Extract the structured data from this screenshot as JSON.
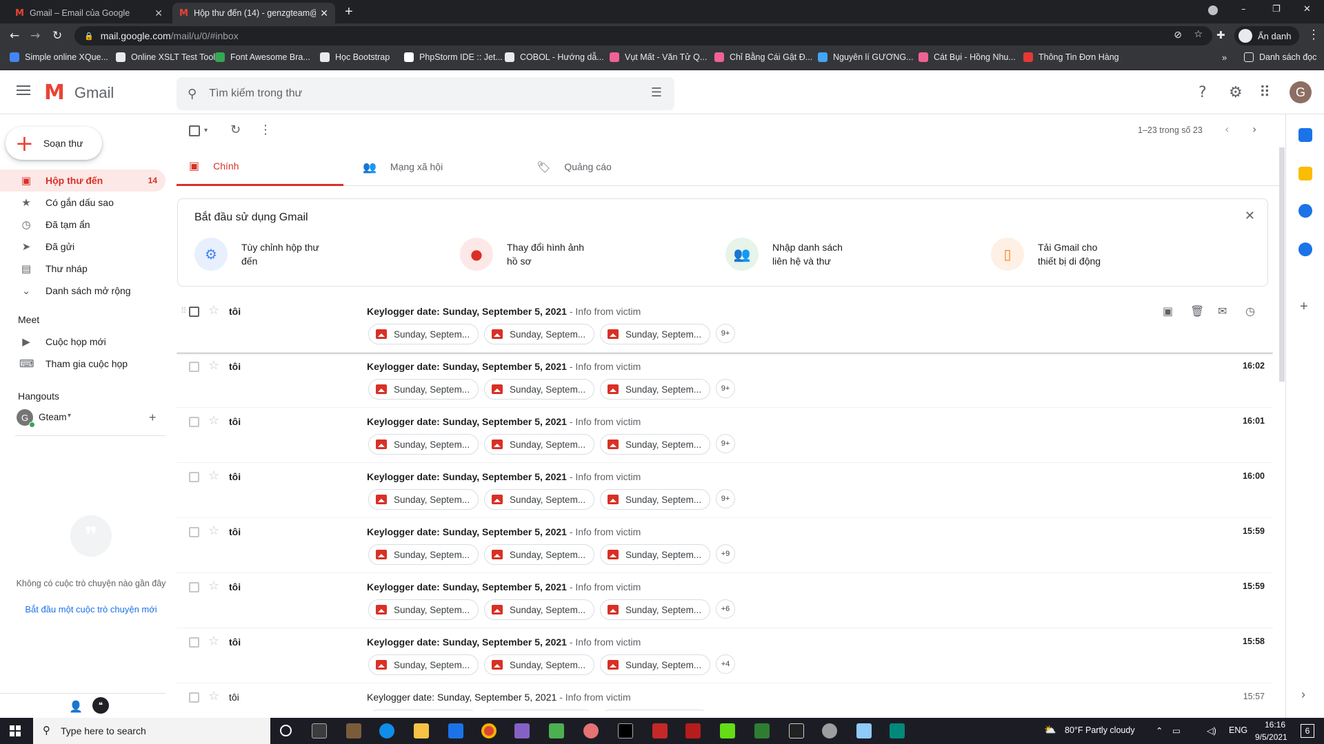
{
  "browser": {
    "tabs": [
      {
        "label": "Gmail – Email của Google",
        "active": false
      },
      {
        "label": "Hộp thư đến (14) - genzgteam@",
        "active": true
      }
    ],
    "url_host": "mail.google.com",
    "url_path": "/mail/u/0/#inbox",
    "profile_label": "Ẩn danh",
    "bookmarks": [
      {
        "label": "Simple online XQue...",
        "color": "#4285f4"
      },
      {
        "label": "Online XSLT Test Tool",
        "color": "#e8eaed"
      },
      {
        "label": "Font Awesome Bra...",
        "color": "#34a853"
      },
      {
        "label": "Học Bootstrap",
        "color": "#e8eaed"
      },
      {
        "label": "PhpStorm IDE :: Jet...",
        "color": "#ffffff"
      },
      {
        "label": "COBOL - Hướng dẫ...",
        "color": "#e8eaed"
      },
      {
        "label": "Vụt Mất - Văn Tử Q...",
        "color": "#f06292"
      },
      {
        "label": "Chỉ Bằng Cái Gật Đ...",
        "color": "#f06292"
      },
      {
        "label": "Nguyên lí GƯƠNG...",
        "color": "#42a5f5"
      },
      {
        "label": "Cát Bụi - Hồng Nhu...",
        "color": "#f06292"
      },
      {
        "label": "Thông Tin Đơn Hàng",
        "color": "#e53935"
      }
    ],
    "reading_list": "Danh sách đọc"
  },
  "gmail": {
    "logo_text": "Gmail",
    "search_placeholder": "Tìm kiếm trong thư",
    "avatar_letter": "G",
    "compose_label": "Soạn thư",
    "nav": [
      {
        "label": "Hộp thư đến",
        "count": "14",
        "icon": "inbox-icon",
        "glyph": "▣",
        "active": true
      },
      {
        "label": "Có gắn dấu sao",
        "count": "",
        "icon": "star-icon",
        "glyph": "★",
        "active": false
      },
      {
        "label": "Đã tạm ẩn",
        "count": "",
        "icon": "clock-icon",
        "glyph": "◷",
        "active": false
      },
      {
        "label": "Đã gửi",
        "count": "",
        "icon": "send-icon",
        "glyph": "➤",
        "active": false
      },
      {
        "label": "Thư nháp",
        "count": "",
        "icon": "draft-icon",
        "glyph": "▤",
        "active": false
      },
      {
        "label": "Danh sách mở rộng",
        "count": "",
        "icon": "chevron-down-icon",
        "glyph": "⌄",
        "active": false
      }
    ],
    "meet": {
      "title": "Meet",
      "items": [
        "Cuộc họp mới",
        "Tham gia cuộc họp"
      ]
    },
    "hangouts": {
      "title": "Hangouts",
      "user": "Gteam",
      "empty_text": "Không có cuộc trò chuyện nào gần đây",
      "start_link": "Bắt đầu một cuộc trò chuyện mới"
    },
    "pagination": "1–23 trong số 23",
    "category_tabs": [
      {
        "label": "Chính",
        "active": true
      },
      {
        "label": "Mạng xã hội",
        "active": false
      },
      {
        "label": "Quảng cáo",
        "active": false
      }
    ],
    "getting_started": {
      "title": "Bắt đầu sử dụng Gmail",
      "items": [
        {
          "line1": "Tùy chỉnh hộp thư",
          "line2": "đến",
          "bg": "#e8f0fe",
          "fg": "#4285f4",
          "glyph": "⚙"
        },
        {
          "line1": "Thay đổi hình ảnh",
          "line2": "hồ sơ",
          "bg": "#fce8e6",
          "fg": "#d93025",
          "glyph": "●"
        },
        {
          "line1": "Nhập danh sách",
          "line2": "liên hệ và thư",
          "bg": "#e6f4ea",
          "fg": "#1e8e3e",
          "glyph": "👥"
        },
        {
          "line1": "Tải Gmail cho",
          "line2": "thiết bị di động",
          "bg": "#fef0e5",
          "fg": "#fa7b17",
          "glyph": "▯"
        }
      ]
    },
    "emails": [
      {
        "sender": "tôi",
        "subject": "Keylogger date: Sunday, September 5, 2021",
        "snippet": " - Info from victim",
        "time": "",
        "chips": [
          "Sunday, Septem...",
          "Sunday, Septem...",
          "Sunday, Septem..."
        ],
        "more": "9+",
        "read": false
      },
      {
        "sender": "tôi",
        "subject": "Keylogger date: Sunday, September 5, 2021",
        "snippet": " - Info from victim",
        "time": "16:02",
        "chips": [
          "Sunday, Septem...",
          "Sunday, Septem...",
          "Sunday, Septem..."
        ],
        "more": "9+",
        "read": false
      },
      {
        "sender": "tôi",
        "subject": "Keylogger date: Sunday, September 5, 2021",
        "snippet": " - Info from victim",
        "time": "16:01",
        "chips": [
          "Sunday, Septem...",
          "Sunday, Septem...",
          "Sunday, Septem..."
        ],
        "more": "9+",
        "read": false
      },
      {
        "sender": "tôi",
        "subject": "Keylogger date: Sunday, September 5, 2021",
        "snippet": " - Info from victim",
        "time": "16:00",
        "chips": [
          "Sunday, Septem...",
          "Sunday, Septem...",
          "Sunday, Septem..."
        ],
        "more": "9+",
        "read": false
      },
      {
        "sender": "tôi",
        "subject": "Keylogger date: Sunday, September 5, 2021",
        "snippet": " - Info from victim",
        "time": "15:59",
        "chips": [
          "Sunday, Septem...",
          "Sunday, Septem...",
          "Sunday, Septem..."
        ],
        "more": "+9",
        "read": false
      },
      {
        "sender": "tôi",
        "subject": "Keylogger date: Sunday, September 5, 2021",
        "snippet": " - Info from victim",
        "time": "15:59",
        "chips": [
          "Sunday, Septem...",
          "Sunday, Septem...",
          "Sunday, Septem..."
        ],
        "more": "+6",
        "read": false
      },
      {
        "sender": "tôi",
        "subject": "Keylogger date: Sunday, September 5, 2021",
        "snippet": " - Info from victim",
        "time": "15:58",
        "chips": [
          "Sunday, Septem...",
          "Sunday, Septem...",
          "Sunday, Septem..."
        ],
        "more": "+4",
        "read": false
      },
      {
        "sender": "tôi",
        "subject": "Keylogger date: Sunday, September 5, 2021",
        "snippet": " - Info from victim",
        "time": "15:57",
        "chips": [
          "Sunday, Septem...",
          "Sunday, Septem...",
          "Sunday, Septem..."
        ],
        "more": "",
        "read": true
      }
    ]
  },
  "taskbar": {
    "search_placeholder": "Type here to search",
    "weather": "80°F  Partly cloudy",
    "lang": "ENG",
    "time": "16:16",
    "date": "9/5/2021",
    "notif": "6"
  }
}
